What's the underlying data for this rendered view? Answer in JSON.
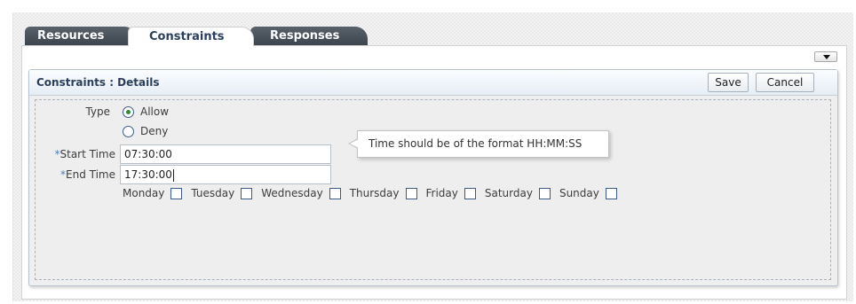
{
  "tabs": [
    {
      "label": "Resources",
      "active": false
    },
    {
      "label": "Constraints",
      "active": true
    },
    {
      "label": "Responses",
      "active": false
    }
  ],
  "details": {
    "title": "Constraints : Details",
    "save_label": "Save",
    "cancel_label": "Cancel"
  },
  "form": {
    "type_label": "Type",
    "type_options": [
      {
        "label": "Allow",
        "selected": true
      },
      {
        "label": "Deny",
        "selected": false
      }
    ],
    "required_marker": "*",
    "start_time_label": "Start Time",
    "start_time_value": "07:30:00",
    "end_time_label": "End Time",
    "end_time_value": "17:30:00",
    "tooltip": "Time should be of the format HH:MM:SS",
    "days": [
      {
        "label": "Monday",
        "checked": false
      },
      {
        "label": "Tuesday",
        "checked": false
      },
      {
        "label": "Wednesday",
        "checked": false
      },
      {
        "label": "Thursday",
        "checked": false
      },
      {
        "label": "Friday",
        "checked": false
      },
      {
        "label": "Saturday",
        "checked": false
      },
      {
        "label": "Sunday",
        "checked": false
      }
    ]
  },
  "colors": {
    "tab_dark": "#3b434c",
    "title_text": "#2b3f5c",
    "radio_selected": "#2f8a3a",
    "required_marker": "#4f7fb8"
  },
  "icons": [
    "panel-menu-icon",
    "chevron-down-icon"
  ]
}
